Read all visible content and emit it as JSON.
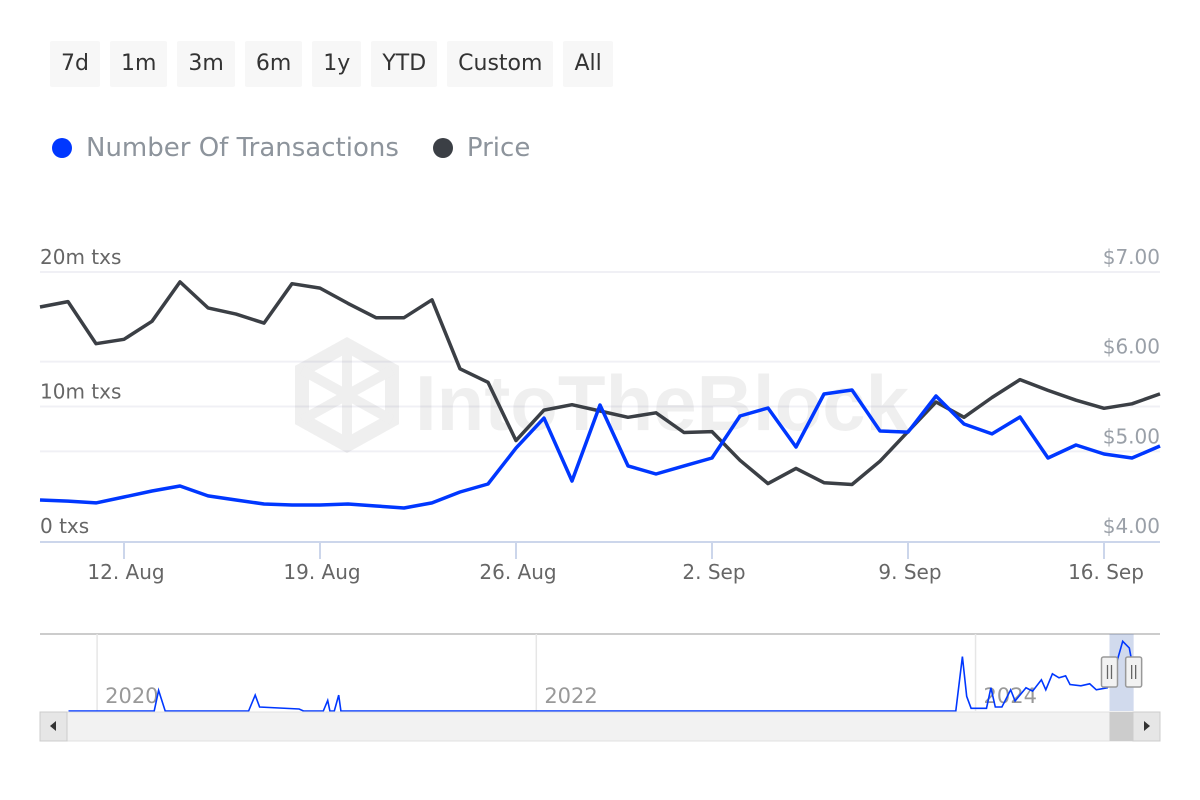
{
  "range_selector": {
    "buttons": [
      "7d",
      "1m",
      "3m",
      "6m",
      "1y",
      "YTD",
      "Custom",
      "All"
    ]
  },
  "colors": {
    "transactions": "#0037ff",
    "price": "#3b3f45",
    "grid": "#f0f0f5",
    "axis": "#ccd6eb"
  },
  "watermark": "IntoTheBlock",
  "chart_data": {
    "type": "line",
    "title": "",
    "legend_placement": "top-left",
    "grid": true,
    "x": [
      "2024-08-09",
      "2024-08-10",
      "2024-08-11",
      "2024-08-12",
      "2024-08-13",
      "2024-08-14",
      "2024-08-15",
      "2024-08-16",
      "2024-08-17",
      "2024-08-18",
      "2024-08-19",
      "2024-08-20",
      "2024-08-21",
      "2024-08-22",
      "2024-08-23",
      "2024-08-24",
      "2024-08-25",
      "2024-08-26",
      "2024-08-27",
      "2024-08-28",
      "2024-08-29",
      "2024-08-30",
      "2024-08-31",
      "2024-09-01",
      "2024-09-02",
      "2024-09-03",
      "2024-09-04",
      "2024-09-05",
      "2024-09-06",
      "2024-09-07",
      "2024-09-08",
      "2024-09-09",
      "2024-09-10",
      "2024-09-11",
      "2024-09-12",
      "2024-09-13",
      "2024-09-14",
      "2024-09-15",
      "2024-09-16",
      "2024-09-17",
      "2024-09-18"
    ],
    "x_ticks": [
      "12. Aug",
      "19. Aug",
      "26. Aug",
      "2. Sep",
      "9. Sep",
      "16. Sep"
    ],
    "x_tick_dates": [
      "2024-08-12",
      "2024-08-19",
      "2024-08-26",
      "2024-09-02",
      "2024-09-09",
      "2024-09-16"
    ],
    "series": [
      {
        "name": "Number Of Transactions",
        "axis": "left",
        "unit": "m txs",
        "values": [
          3.05,
          2.97,
          2.83,
          3.27,
          3.72,
          4.09,
          3.35,
          3.05,
          2.75,
          2.68,
          2.68,
          2.75,
          2.6,
          2.45,
          2.83,
          3.64,
          4.24,
          6.91,
          9.14,
          4.46,
          10.11,
          5.58,
          4.98,
          5.58,
          6.17,
          9.29,
          9.89,
          6.99,
          10.93,
          11.23,
          8.18,
          8.1,
          10.78,
          8.7,
          7.96,
          9.22,
          6.17,
          7.14,
          6.47,
          6.17,
          7.06
        ]
      },
      {
        "name": "Price",
        "axis": "right",
        "unit": "USD",
        "values": [
          6.61,
          6.67,
          6.2,
          6.25,
          6.45,
          6.89,
          6.6,
          6.53,
          6.43,
          6.87,
          6.82,
          6.65,
          6.49,
          6.49,
          6.69,
          5.92,
          5.77,
          5.12,
          5.46,
          5.52,
          5.45,
          5.38,
          5.43,
          5.21,
          5.22,
          4.9,
          4.64,
          4.81,
          4.65,
          4.63,
          4.89,
          5.22,
          5.55,
          5.38,
          5.6,
          5.8,
          5.68,
          5.57,
          5.48,
          5.53,
          5.64
        ]
      }
    ],
    "y_left": {
      "ylim": [
        0,
        20
      ],
      "ticks": [
        0,
        10,
        20
      ],
      "tick_labels": [
        "0 txs",
        "10m txs",
        "20m txs"
      ]
    },
    "y_right": {
      "ylim": [
        4,
        7
      ],
      "ticks": [
        4,
        5,
        6,
        7
      ],
      "tick_labels": [
        "$4.00",
        "$5.00",
        "$6.00",
        "$7.00"
      ]
    }
  },
  "navigator": {
    "xlim": [
      2019.74,
      2024.84
    ],
    "ylim": [
      0,
      11
    ],
    "year_labels": [
      "2020",
      "2022",
      "2024"
    ],
    "year_values": [
      2020,
      2022,
      2024
    ],
    "selected_range": [
      2024.61,
      2024.72
    ],
    "points": [
      [
        2019.87,
        0
      ],
      [
        2020.26,
        0
      ],
      [
        2020.28,
        3.1
      ],
      [
        2020.31,
        0
      ],
      [
        2020.69,
        0
      ],
      [
        2020.72,
        2.4
      ],
      [
        2020.74,
        0.6
      ],
      [
        2020.92,
        0.3
      ],
      [
        2020.94,
        0
      ],
      [
        2021.03,
        0
      ],
      [
        2021.05,
        1.6
      ],
      [
        2021.06,
        0
      ],
      [
        2021.08,
        0
      ],
      [
        2021.1,
        2.4
      ],
      [
        2021.11,
        0
      ],
      [
        2023.91,
        0
      ],
      [
        2023.94,
        8.2
      ],
      [
        2023.96,
        2.2
      ],
      [
        2023.98,
        0.4
      ],
      [
        2024.05,
        0.4
      ],
      [
        2024.07,
        3.5
      ],
      [
        2024.09,
        0.6
      ],
      [
        2024.12,
        0.6
      ],
      [
        2024.16,
        3.2
      ],
      [
        2024.18,
        1.5
      ],
      [
        2024.23,
        3.5
      ],
      [
        2024.26,
        3.0
      ],
      [
        2024.3,
        4.7
      ],
      [
        2024.32,
        3.2
      ],
      [
        2024.35,
        5.6
      ],
      [
        2024.38,
        5.0
      ],
      [
        2024.41,
        5.3
      ],
      [
        2024.43,
        4.0
      ],
      [
        2024.48,
        3.8
      ],
      [
        2024.52,
        4.1
      ],
      [
        2024.55,
        3.2
      ],
      [
        2024.6,
        3.5
      ],
      [
        2024.64,
        7
      ],
      [
        2024.67,
        10.5
      ],
      [
        2024.7,
        9.5
      ],
      [
        2024.72,
        6
      ]
    ]
  }
}
